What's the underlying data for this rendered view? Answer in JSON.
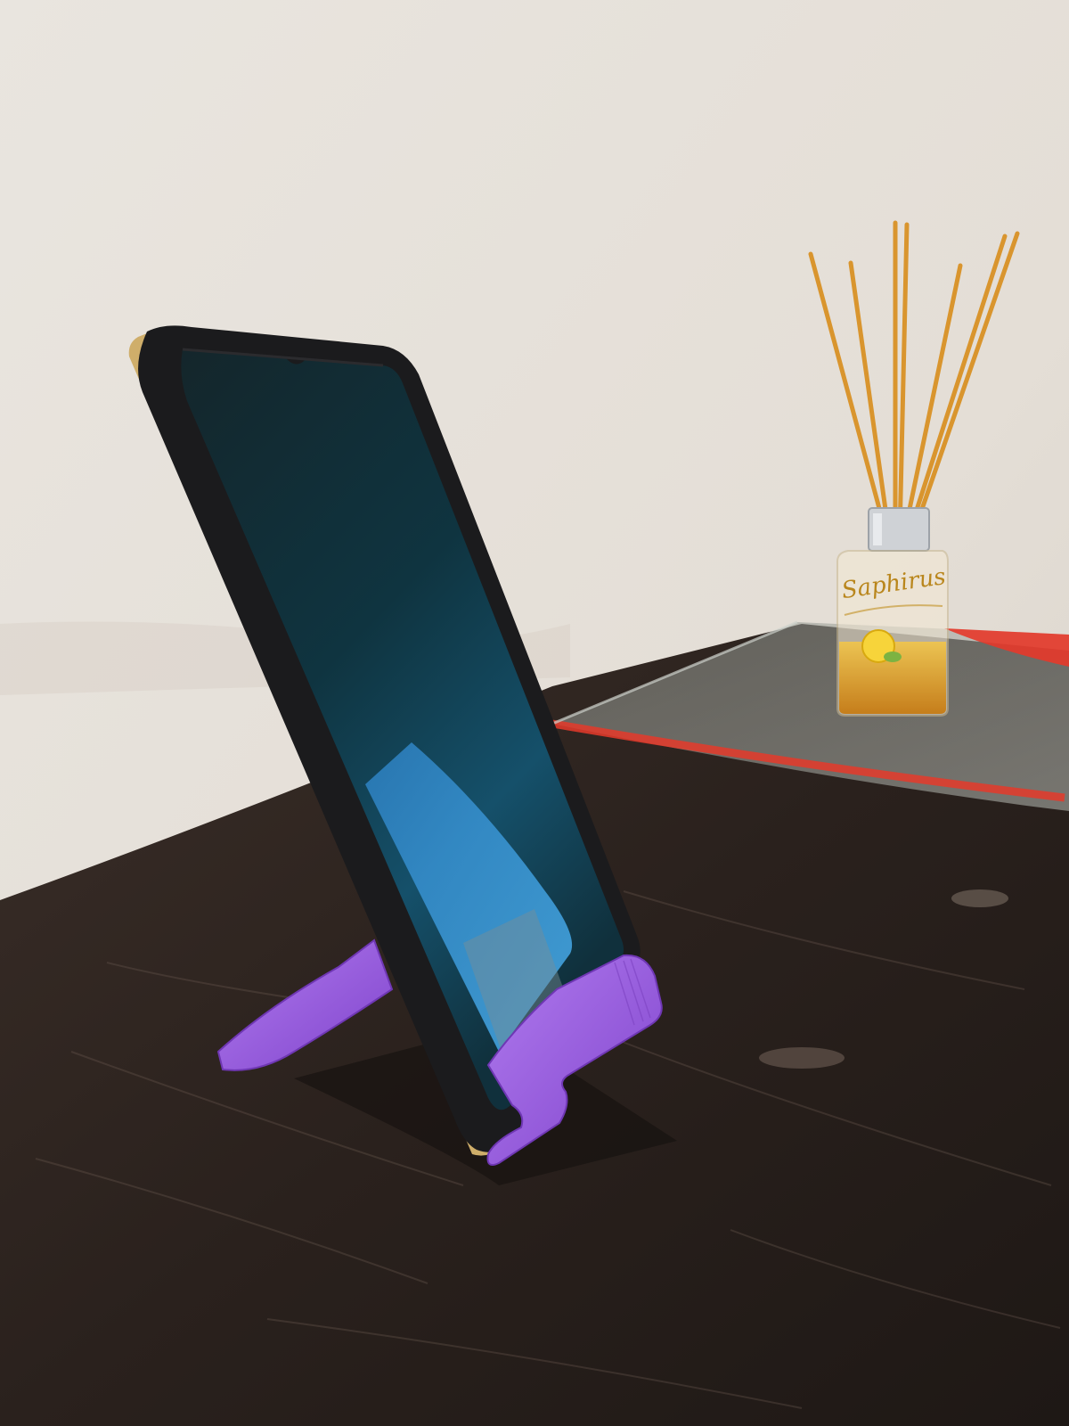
{
  "scene": {
    "subject": "smartphone-on-stand",
    "diffuser_label": "Saphirus",
    "colors": {
      "wall": "#e8e3dc",
      "table": "#2a211d",
      "stand": "#9b5be0",
      "phone_case": "#1b1b1d",
      "phone_screen": "#0f2a33",
      "screen_reflection": "#3fa0e0",
      "gold_edge": "#cfae6a",
      "tray_red": "#e5392a",
      "oil": "#e6a21c",
      "reeds": "#d9952e",
      "cap": "#cfd2d6"
    }
  }
}
